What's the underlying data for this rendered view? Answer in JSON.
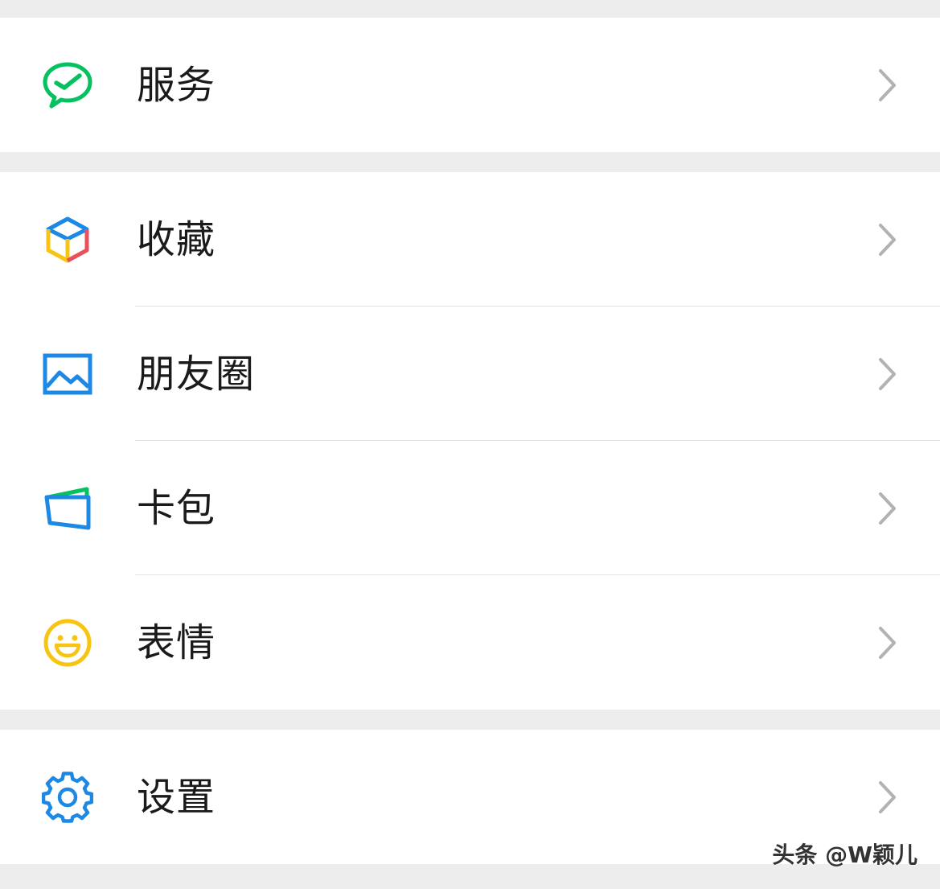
{
  "menu": {
    "services": {
      "label": "服务",
      "icon": "services-check-bubble-icon"
    },
    "favorites": {
      "label": "收藏",
      "icon": "favorites-cube-icon"
    },
    "moments": {
      "label": "朋友圈",
      "icon": "moments-picture-icon"
    },
    "card_wallet": {
      "label": "卡包",
      "icon": "card-wallet-icon"
    },
    "stickers": {
      "label": "表情",
      "icon": "stickers-smiley-icon"
    },
    "settings": {
      "label": "设置",
      "icon": "settings-gear-icon"
    }
  },
  "watermark": "头条 @W颖儿",
  "colors": {
    "background": "#ededed",
    "row": "#ffffff",
    "services_green": "#07c160",
    "blue": "#1e88e5",
    "yellow": "#f7c511",
    "red": "#e8505b",
    "chevron": "#b2b2b2"
  }
}
